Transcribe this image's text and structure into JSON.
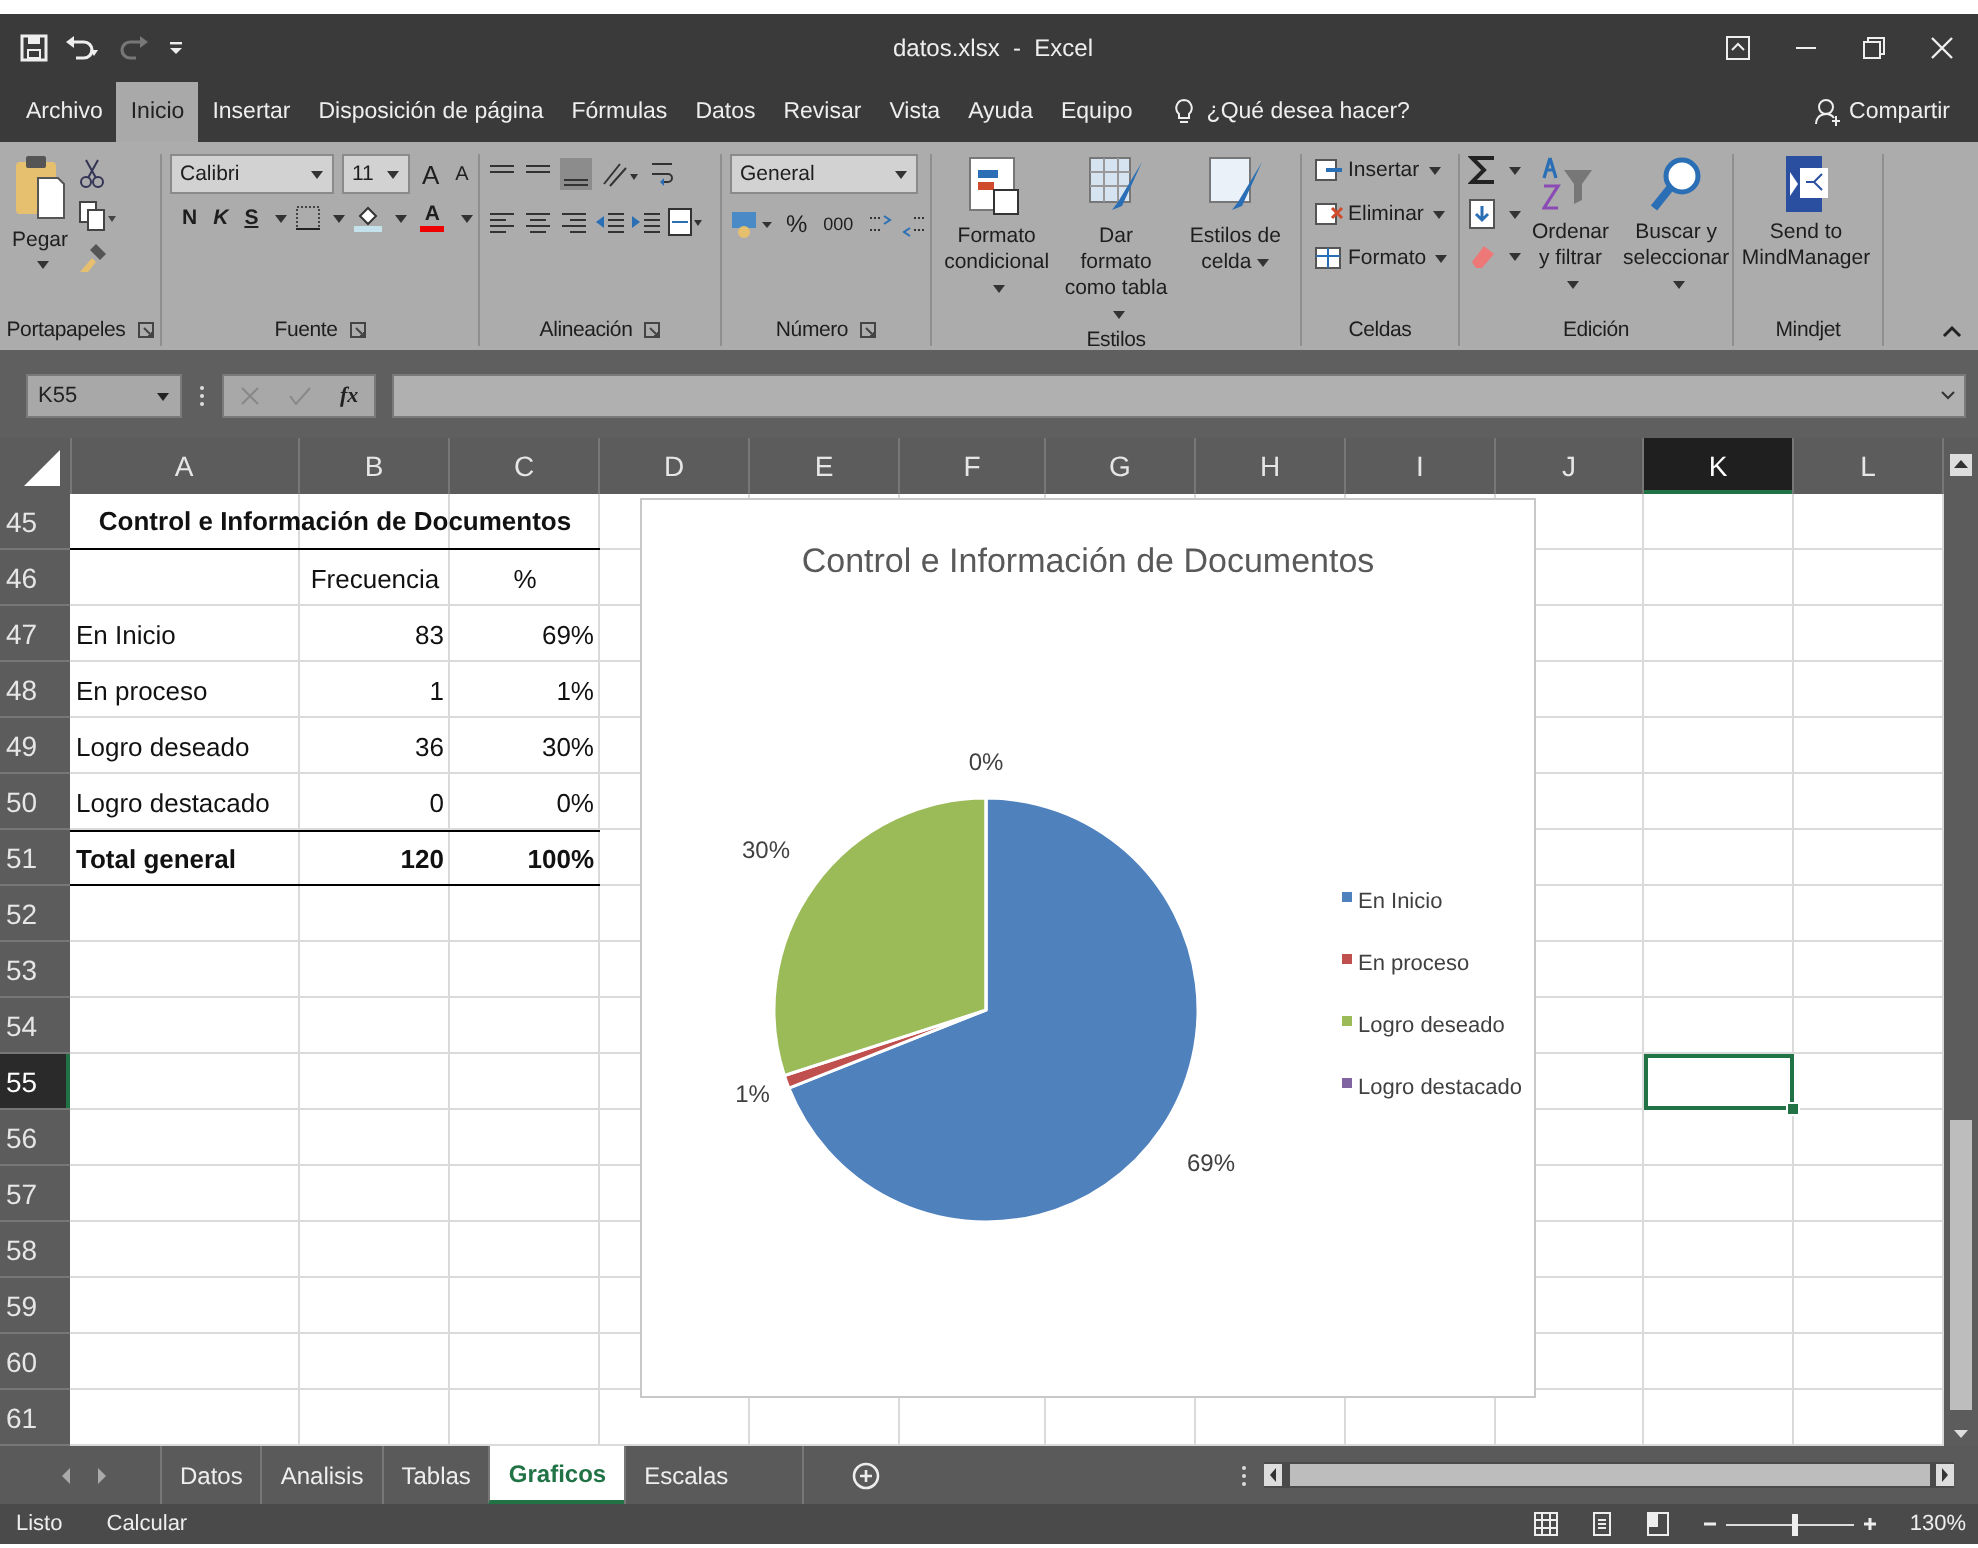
{
  "title_bar": {
    "title": "datos.xlsx  -  Excel"
  },
  "menu_tabs": [
    {
      "label": "Archivo",
      "selected": false
    },
    {
      "label": "Inicio",
      "selected": true
    },
    {
      "label": "Insertar",
      "selected": false
    },
    {
      "label": "Disposición de página",
      "selected": false
    },
    {
      "label": "Fórmulas",
      "selected": false
    },
    {
      "label": "Datos",
      "selected": false
    },
    {
      "label": "Revisar",
      "selected": false
    },
    {
      "label": "Vista",
      "selected": false
    },
    {
      "label": "Ayuda",
      "selected": false
    },
    {
      "label": "Equipo",
      "selected": false
    }
  ],
  "tell_me": "¿Qué desea hacer?",
  "share": "Compartir",
  "ribbon": {
    "groups": [
      {
        "name": "Portapapeles",
        "kind": "clipboard",
        "paste": "Pegar"
      },
      {
        "name": "Fuente",
        "kind": "font",
        "font": "Calibri",
        "size": "11",
        "grow": "A",
        "shrink": "A",
        "bold": "N",
        "italic": "K",
        "underline": "S",
        "font_color": "A"
      },
      {
        "name": "Alineación",
        "kind": "alignment"
      },
      {
        "name": "Número",
        "kind": "number",
        "format": "General",
        "percent": "%",
        "thousands": "000"
      },
      {
        "name": "Estilos",
        "kind": "styles",
        "buttons": [
          "Formato condicional",
          "Dar formato como tabla",
          "Estilos de celda"
        ]
      },
      {
        "name": "Celdas",
        "kind": "cells",
        "buttons": [
          "Insertar",
          "Eliminar",
          "Formato"
        ]
      },
      {
        "name": "Edición",
        "kind": "editing",
        "buttons": [
          "Ordenar y filtrar",
          "Buscar y seleccionar"
        ]
      },
      {
        "name": "Mindjet",
        "kind": "mindjet",
        "buttons": [
          "Send to MindManager"
        ]
      }
    ]
  },
  "formula_bar": {
    "name_box": "K55",
    "function_label": "fx"
  },
  "sheet": {
    "columns": [
      {
        "label": "A",
        "selected": false
      },
      {
        "label": "B",
        "selected": false
      },
      {
        "label": "C",
        "selected": false
      },
      {
        "label": "D",
        "selected": false
      },
      {
        "label": "E",
        "selected": false
      },
      {
        "label": "F",
        "selected": false
      },
      {
        "label": "G",
        "selected": false
      },
      {
        "label": "H",
        "selected": false
      },
      {
        "label": "I",
        "selected": false
      },
      {
        "label": "J",
        "selected": false
      },
      {
        "label": "K",
        "selected": true
      },
      {
        "label": "L",
        "selected": false
      }
    ],
    "rows": [
      {
        "number": "45",
        "selected": false
      },
      {
        "number": "46",
        "selected": false
      },
      {
        "number": "47",
        "selected": false
      },
      {
        "number": "48",
        "selected": false
      },
      {
        "number": "49",
        "selected": false
      },
      {
        "number": "50",
        "selected": false
      },
      {
        "number": "51",
        "selected": false
      },
      {
        "number": "52",
        "selected": false
      },
      {
        "number": "53",
        "selected": false
      },
      {
        "number": "54",
        "selected": false
      },
      {
        "number": "55",
        "selected": true
      },
      {
        "number": "56",
        "selected": false
      },
      {
        "number": "57",
        "selected": false
      },
      {
        "number": "58",
        "selected": false
      },
      {
        "number": "59",
        "selected": false
      },
      {
        "number": "60",
        "selected": false
      },
      {
        "number": "61",
        "selected": false
      }
    ],
    "table": {
      "title": "Control e Información de Documentos",
      "header": [
        "Frecuencia",
        "%"
      ],
      "rows": [
        [
          "En Inicio",
          "83",
          "69%"
        ],
        [
          "En proceso",
          "1",
          "1%"
        ],
        [
          "Logro deseado",
          "36",
          "30%"
        ],
        [
          "Logro destacado",
          "0",
          "0%"
        ]
      ],
      "total": [
        "Total general",
        "120",
        "100%"
      ]
    }
  },
  "chart": {
    "chart_data": {
      "type": "pie",
      "title": "Control e Información de Documentos",
      "categories": [
        "En Inicio",
        "En proceso",
        "Logro deseado",
        "Logro destacado"
      ],
      "legend": "right",
      "series": [
        {
          "colors": [
            "#4f81bd",
            "#c0504d",
            "#9bbb59",
            "#8064a2"
          ],
          "values": [
            69,
            1,
            30,
            0
          ]
        }
      ],
      "value_labels": [
        "69%",
        "1%",
        "30%",
        "0%"
      ]
    }
  },
  "sheet_tabs": [
    {
      "label": "Datos",
      "selected": false
    },
    {
      "label": "Analisis",
      "selected": false
    },
    {
      "label": "Tablas",
      "selected": false
    },
    {
      "label": "Graficos",
      "selected": true
    },
    {
      "label": "Escalas",
      "selected": false
    }
  ],
  "status_bar": {
    "mode": "Listo",
    "calc": "Calcular",
    "zoom": {
      "label": "130%",
      "level": 0.53
    }
  }
}
